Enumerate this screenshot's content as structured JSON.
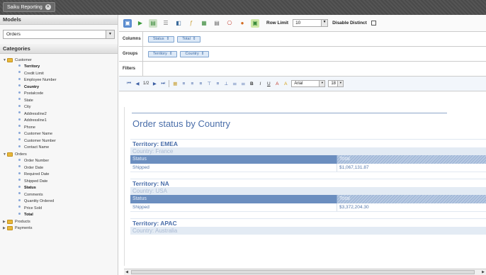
{
  "app": {
    "tab_label": "Saiku Reporting"
  },
  "sidebar": {
    "models_header": "Models",
    "model_value": "Orders",
    "categories_header": "Categories",
    "groups": [
      {
        "label": "Customer",
        "expanded": true,
        "items": [
          {
            "label": "Territory",
            "bold": true
          },
          {
            "label": "Credit Limit",
            "bold": false
          },
          {
            "label": "Employee Number",
            "bold": false
          },
          {
            "label": "Country",
            "bold": true
          },
          {
            "label": "Postalcode",
            "bold": false
          },
          {
            "label": "State",
            "bold": false
          },
          {
            "label": "City",
            "bold": false
          },
          {
            "label": "Addressline2",
            "bold": false
          },
          {
            "label": "Addressline1",
            "bold": false
          },
          {
            "label": "Phone",
            "bold": false
          },
          {
            "label": "Customer Name",
            "bold": false
          },
          {
            "label": "Customer Number",
            "bold": false
          },
          {
            "label": "Contact Name",
            "bold": false
          }
        ]
      },
      {
        "label": "Orders",
        "expanded": true,
        "items": [
          {
            "label": "Order Number",
            "bold": false
          },
          {
            "label": "Order Date",
            "bold": false
          },
          {
            "label": "Required Date",
            "bold": false
          },
          {
            "label": "Shipped Date",
            "bold": false
          },
          {
            "label": "Status",
            "bold": true
          },
          {
            "label": "Comments",
            "bold": false
          },
          {
            "label": "Quantity Ordered",
            "bold": false
          },
          {
            "label": "Price Sold",
            "bold": false
          },
          {
            "label": "Total",
            "bold": true
          }
        ]
      },
      {
        "label": "Products",
        "expanded": false,
        "items": []
      },
      {
        "label": "Payments",
        "expanded": false,
        "items": []
      }
    ]
  },
  "toolbar": {
    "row_limit_label": "Row Limit",
    "row_limit_value": "10",
    "distinct_label": "Disable Distinct"
  },
  "axes": {
    "columns_label": "Columns",
    "columns": [
      "Status",
      "Total"
    ],
    "groups_label": "Groups",
    "groups": [
      "Territory",
      "Country"
    ],
    "filters_label": "Filters"
  },
  "format": {
    "page": "1/2",
    "font": "Arial",
    "size": "18"
  },
  "report": {
    "title": "Order status by Country",
    "sections": [
      {
        "territory": "Territory: EMEA",
        "country": "Country: France",
        "col1": "Status",
        "col2": "Total",
        "rows": [
          {
            "status": "Shipped",
            "total": "$1,067,131.87"
          }
        ]
      },
      {
        "territory": "Territory: NA",
        "country": "Country: USA",
        "col1": "Status",
        "col2": "Total",
        "rows": [
          {
            "status": "Shipped",
            "total": "$3,372,204.30"
          }
        ]
      },
      {
        "territory": "Territory: APAC",
        "country": "Country: Australia",
        "col1": "",
        "col2": "",
        "rows": []
      }
    ]
  },
  "colors": {
    "accent": "#4a6ea9",
    "header_bg": "#6b8ebf"
  }
}
